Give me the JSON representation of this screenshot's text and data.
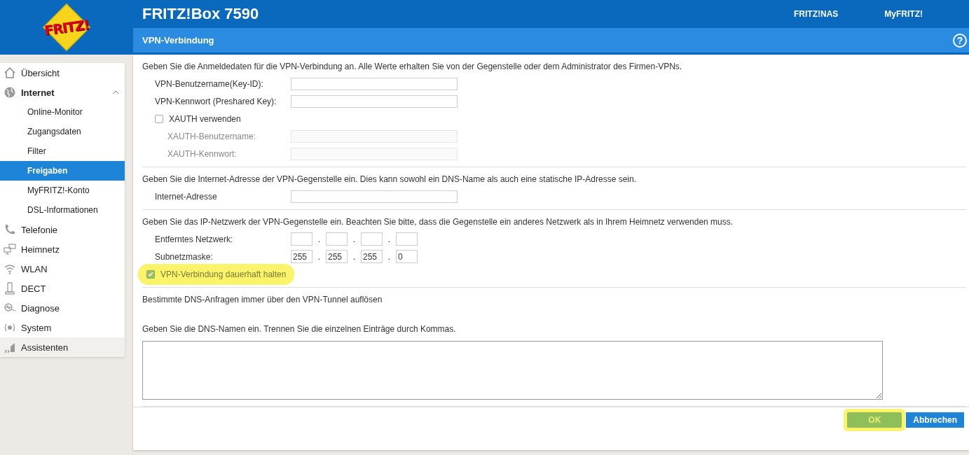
{
  "header": {
    "logo": "FRITZ!",
    "title": "FRITZ!Box 7590",
    "links": [
      "FRITZ!NAS",
      "MyFRITZ!"
    ]
  },
  "page": {
    "title": "VPN-Verbindung",
    "help": "?"
  },
  "sidebar": {
    "items": [
      {
        "label": "Übersicht",
        "kind": "nav",
        "selected": false
      },
      {
        "label": "Internet",
        "kind": "nav",
        "selected": false,
        "expanded": true,
        "children": [
          {
            "label": "Online-Monitor",
            "selected": false
          },
          {
            "label": "Zugangsdaten",
            "selected": false
          },
          {
            "label": "Filter",
            "selected": false
          },
          {
            "label": "Freigaben",
            "selected": true
          },
          {
            "label": "MyFRITZ!-Konto",
            "selected": false
          },
          {
            "label": "DSL-Informationen",
            "selected": false
          }
        ]
      },
      {
        "label": "Telefonie",
        "kind": "nav",
        "selected": false
      },
      {
        "label": "Heimnetz",
        "kind": "nav",
        "selected": false
      },
      {
        "label": "WLAN",
        "kind": "nav",
        "selected": false
      },
      {
        "label": "DECT",
        "kind": "nav",
        "selected": false
      },
      {
        "label": "Diagnose",
        "kind": "nav",
        "selected": false
      },
      {
        "label": "System",
        "kind": "nav",
        "selected": false
      },
      {
        "label": "Assistenten",
        "kind": "assistant",
        "selected": false
      }
    ]
  },
  "sections": [
    {
      "intro": "Geben Sie die Anmeldedaten für die VPN-Verbindung an. Alle Werte erhalten Sie von der Gegenstelle oder dem Administrator des Firmen-VPNs.",
      "rows": [
        {
          "kind": "text",
          "label": "VPN-Benutzername(Key-ID):",
          "disabled": false
        },
        {
          "kind": "text",
          "label": "VPN-Kennwort (Preshared Key):",
          "disabled": false
        },
        {
          "kind": "checkbox",
          "label": "XAUTH verwenden",
          "checked": false,
          "highlighted": false
        },
        {
          "kind": "text",
          "label": "XAUTH-Benutzername:",
          "disabled": true
        },
        {
          "kind": "text",
          "label": "XAUTH-Kennwort:",
          "disabled": true
        }
      ]
    },
    {
      "intro": "Geben Sie die Internet-Adresse der VPN-Gegenstelle ein. Dies kann sowohl ein DNS-Name als auch eine statische IP-Adresse sein.",
      "rows": [
        {
          "kind": "text",
          "label": "Internet-Adresse",
          "disabled": false
        }
      ]
    },
    {
      "intro": "Geben Sie das IP-Netzwerk der VPN-Gegenstelle ein. Beachten Sie bitte, dass die Gegenstelle ein anderes Netzwerk als in Ihrem Heimnetz verwenden muss.",
      "rows": [
        {
          "kind": "ip",
          "label": "Entferntes Netzwerk:",
          "separator": "."
        },
        {
          "kind": "ip",
          "label": "Subnetzmaske:",
          "separator": ".",
          "octets": [
            {
              "value": "255"
            },
            {
              "value": "255"
            },
            {
              "value": "255"
            },
            {
              "value": "0"
            }
          ]
        },
        {
          "kind": "checkbox",
          "label": "VPN-Verbindung dauerhaft halten",
          "checked": true,
          "highlighted": true
        }
      ]
    },
    {
      "intro": "Bestimmte DNS-Anfragen immer über den VPN-Tunnel auflösen",
      "rows": [
        {
          "kind": "note",
          "label": "Geben Sie die DNS-Namen ein. Trennen Sie die einzelnen Einträge durch Kommas."
        },
        {
          "kind": "textarea"
        }
      ]
    }
  ],
  "buttons": [
    {
      "label": "OK",
      "highlighted": true
    },
    {
      "label": "Abbrechen",
      "highlighted": false
    }
  ]
}
